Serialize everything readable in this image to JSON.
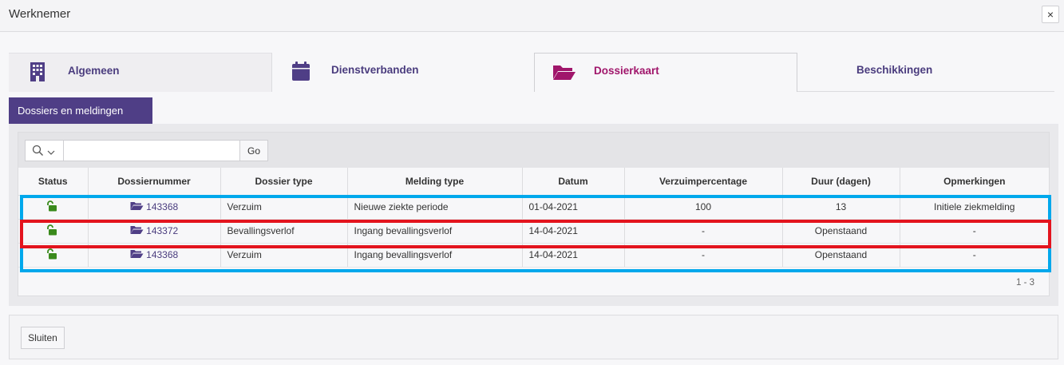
{
  "window": {
    "title": "Werknemer",
    "close_label": "×"
  },
  "tabs": [
    {
      "label": "Algemeen",
      "icon": "building-icon"
    },
    {
      "label": "Dienstverbanden",
      "icon": "calendar-icon"
    },
    {
      "label": "Dossierkaart",
      "icon": "folder-open-icon",
      "active": true
    },
    {
      "label": "Beschikkingen"
    }
  ],
  "subtab": {
    "label": "Dossiers en meldingen"
  },
  "search": {
    "value": "",
    "placeholder": "",
    "go_label": "Go"
  },
  "table": {
    "headers": [
      "Status",
      "Dossiernummer",
      "Dossier type",
      "Melding type",
      "Datum",
      "Verzuimpercentage",
      "Duur (dagen)",
      "Opmerkingen"
    ],
    "rows": [
      {
        "status_icon": "unlock-icon",
        "dossiernummer": "143368",
        "dossier_type": "Verzuim",
        "melding_type": "Nieuwe ziekte periode",
        "datum": "01-04-2021",
        "verzuimpercentage": "100",
        "duur": "13",
        "opmerkingen": "Initiele ziekmelding"
      },
      {
        "status_icon": "unlock-icon",
        "dossiernummer": "143372",
        "dossier_type": "Bevallingsverlof",
        "melding_type": "Ingang bevallingsverlof",
        "datum": "14-04-2021",
        "verzuimpercentage": "-",
        "duur": "Openstaand",
        "opmerkingen": "-"
      },
      {
        "status_icon": "unlock-icon",
        "dossiernummer": "143368",
        "dossier_type": "Verzuim",
        "melding_type": "Ingang bevallingsverlof",
        "datum": "14-04-2021",
        "verzuimpercentage": "-",
        "duur": "Openstaand",
        "opmerkingen": "-"
      }
    ],
    "pager": "1 - 3"
  },
  "footer": {
    "close_label": "Sluiten"
  },
  "colors": {
    "primary": "#4f3e86",
    "active_tab": "#a0166b",
    "status_green": "#3a8a1c",
    "highlight_blue": "#00a8ec",
    "highlight_red": "#e3141e"
  }
}
